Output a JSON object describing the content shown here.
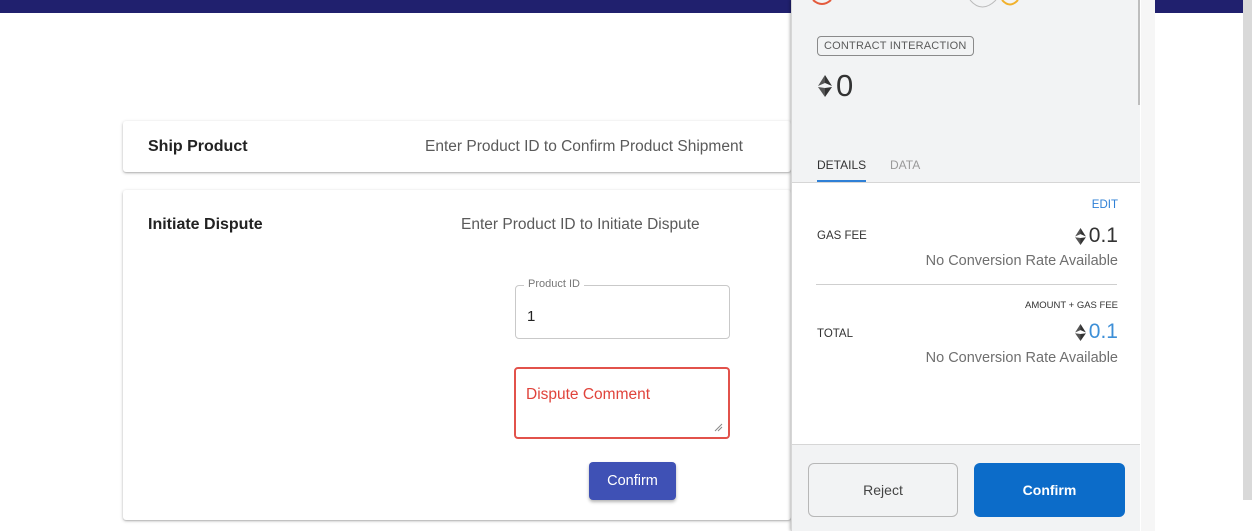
{
  "colors": {
    "topbar": "#20206e",
    "primary_button": "#3f51b5",
    "error": "#e2524b",
    "wallet_confirm": "#0c6cc9",
    "wallet_accent": "#3d8fd7"
  },
  "ship_card": {
    "title": "Ship Product",
    "subtitle": "Enter Product ID to Confirm Product Shipment"
  },
  "dispute_card": {
    "title": "Initiate Dispute",
    "subtitle": "Enter Product ID to Initiate Dispute",
    "product_id_label": "Product ID",
    "product_id_value": "1",
    "comment_placeholder": "Dispute Comment",
    "confirm_label": "Confirm"
  },
  "wallet": {
    "tag": "CONTRACT INTERACTION",
    "amount": "0",
    "tabs": [
      "DETAILS",
      "DATA"
    ],
    "edit_label": "EDIT",
    "gas_fee_label": "GAS FEE",
    "gas_fee_value": "0.1",
    "gas_fee_note": "No Conversion Rate Available",
    "total_caption": "AMOUNT + GAS FEE",
    "total_label": "TOTAL",
    "total_value": "0.1",
    "total_note": "No Conversion Rate Available",
    "reject_label": "Reject",
    "confirm_label": "Confirm",
    "icons": [
      "ethereum-icon"
    ]
  }
}
